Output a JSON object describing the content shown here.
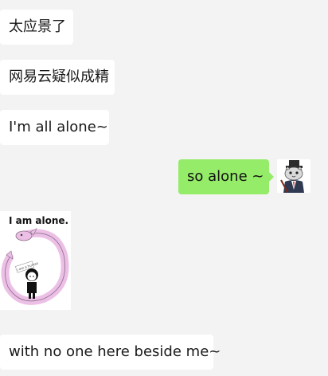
{
  "messages": [
    {
      "text": "太应景了"
    },
    {
      "text": "网易云疑似成精"
    },
    {
      "text": "I'm all alone~"
    },
    {
      "text": "so alone ~"
    },
    {
      "text": "with no one here beside me~"
    }
  ],
  "sticker": {
    "caption": "I am alone.",
    "badge_text": "i am a human"
  },
  "colors": {
    "background": "#f3f3f3",
    "incoming_bubble": "#ffffff",
    "outgoing_bubble": "#95ec69",
    "dragon": "#ecc0e6"
  }
}
